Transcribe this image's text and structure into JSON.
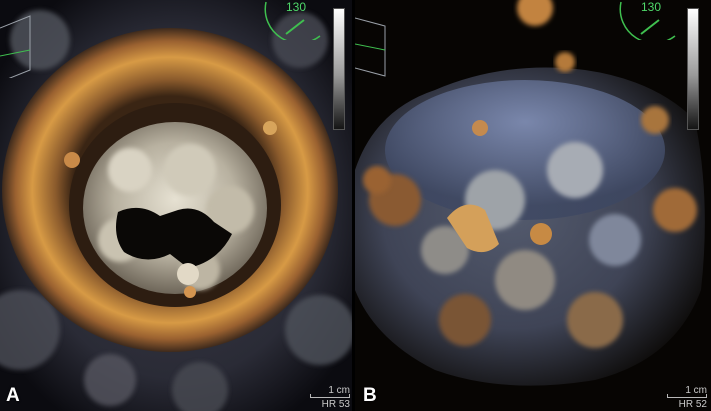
{
  "panels": [
    {
      "letter": "A",
      "angle_label": "130",
      "scale_label": "1 cm",
      "hr_label": "HR 53"
    },
    {
      "letter": "B",
      "angle_label": "130",
      "scale_label": "1 cm",
      "hr_label": "HR 52"
    }
  ],
  "colors": {
    "tissue_orange": "#b8732a",
    "tissue_pale": "#d8d2c2",
    "tissue_blue": "#6f80a8",
    "gauge_green": "#3fbf4f"
  }
}
